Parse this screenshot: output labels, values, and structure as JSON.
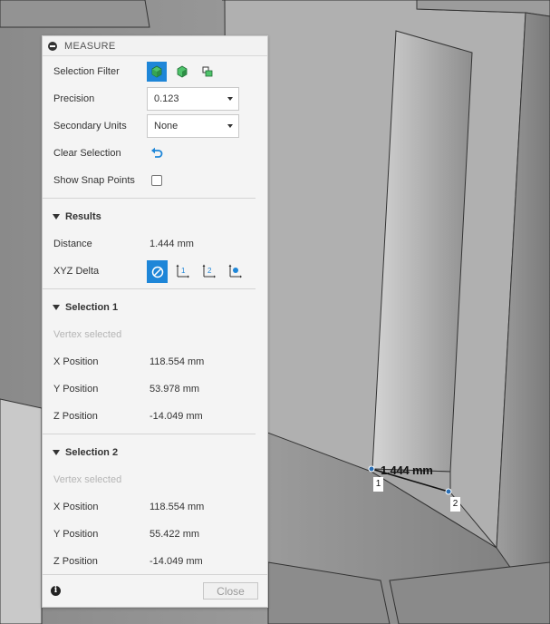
{
  "panel": {
    "title": "MEASURE",
    "selection_filter_label": "Selection Filter",
    "precision_label": "Precision",
    "precision_value": "0.123",
    "secondary_units_label": "Secondary Units",
    "secondary_units_value": "None",
    "clear_selection_label": "Clear Selection",
    "show_snap_points_label": "Show Snap Points",
    "results": {
      "header": "Results",
      "distance_label": "Distance",
      "distance_value": "1.444 mm",
      "xyz_delta_label": "XYZ Delta"
    },
    "selection1": {
      "header": "Selection 1",
      "status": "Vertex selected",
      "x_label": "X Position",
      "x_value": "118.554 mm",
      "y_label": "Y Position",
      "y_value": "53.978 mm",
      "z_label": "Z Position",
      "z_value": "-14.049 mm"
    },
    "selection2": {
      "header": "Selection 2",
      "status": "Vertex selected",
      "x_label": "X Position",
      "x_value": "118.554 mm",
      "y_label": "Y Position",
      "y_value": "55.422 mm",
      "z_label": "Z Position",
      "z_value": "-14.049 mm"
    },
    "close_label": "Close"
  },
  "viewport": {
    "dimension_label": "1.444 mm",
    "point1_label": "1",
    "point2_label": "2"
  },
  "colors": {
    "accent": "#1e86d8",
    "face_green": "#3cb371"
  }
}
